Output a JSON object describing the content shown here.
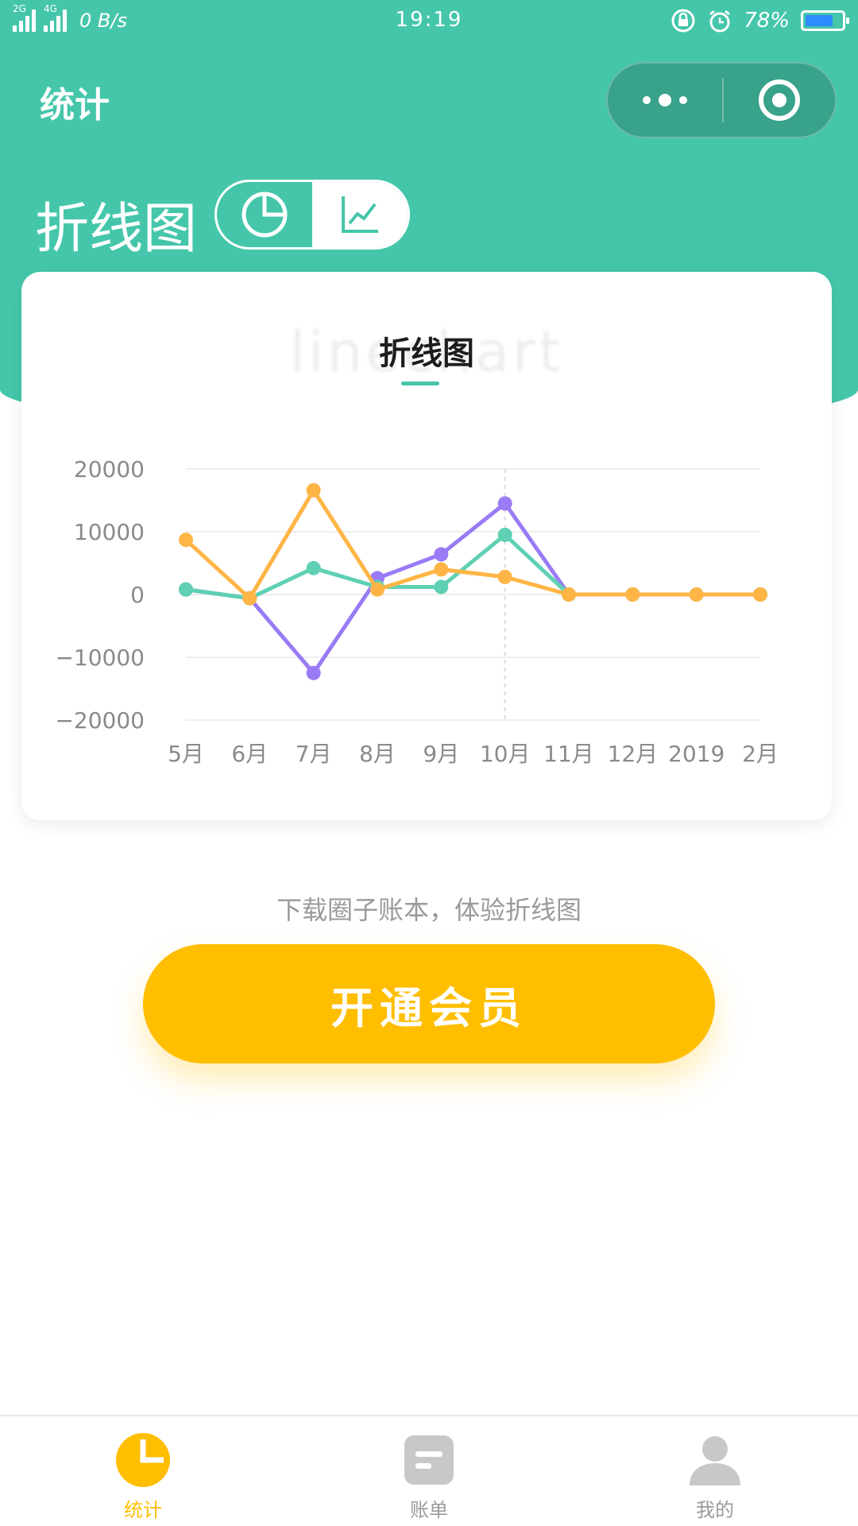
{
  "status_bar": {
    "sim1": "2G",
    "sim2": "4G",
    "net_speed": "0 B/s",
    "time": "19:19",
    "battery": "78%",
    "battery_level": 0.78,
    "battery_color": "#2e8cff"
  },
  "nav": {
    "title": "统计",
    "more_icon": "more-dots-icon",
    "close_icon": "target-close-icon"
  },
  "header": {
    "title": "折线图",
    "toggle": [
      {
        "icon": "pie-chart-icon",
        "active": false
      },
      {
        "icon": "line-chart-icon",
        "active": true
      }
    ]
  },
  "card": {
    "watermark": "linechart",
    "title": "折线图"
  },
  "chart_data": {
    "type": "line",
    "categories": [
      "5月",
      "6月",
      "7月",
      "8月",
      "9月",
      "10月",
      "11月",
      "12月",
      "2019",
      "2月"
    ],
    "ylim": [
      -20000,
      20000
    ],
    "yticks": [
      "20000",
      "10000",
      "0",
      "−10000",
      "−20000"
    ],
    "ytick_values": [
      20000,
      10000,
      0,
      -10000,
      -20000
    ],
    "grid": true,
    "highlight_category": "10月",
    "series": [
      {
        "color": "#9a7bf5",
        "values": [
          800,
          -600,
          -12500,
          2600,
          6400,
          14500,
          0,
          0,
          0,
          0
        ]
      },
      {
        "color": "#5fd0b4",
        "values": [
          800,
          -600,
          4200,
          1200,
          1200,
          9500,
          0,
          0,
          0,
          0
        ]
      },
      {
        "color": "#ffb545",
        "values": [
          8700,
          -600,
          16600,
          800,
          4000,
          2800,
          0,
          0,
          0,
          0
        ]
      }
    ]
  },
  "promo": {
    "text": "下载圈子账本，体验折线图",
    "button": "开通会员"
  },
  "tabbar": {
    "items": [
      {
        "label": "统计",
        "icon": "pie-chart-tab-icon",
        "active": true
      },
      {
        "label": "账单",
        "icon": "bill-tab-icon",
        "active": false
      },
      {
        "label": "我的",
        "icon": "user-tab-icon",
        "active": false
      }
    ]
  },
  "colors": {
    "primary": "#45c6aa",
    "accent": "#ffbe00",
    "inactive": "#c8c8c8"
  }
}
